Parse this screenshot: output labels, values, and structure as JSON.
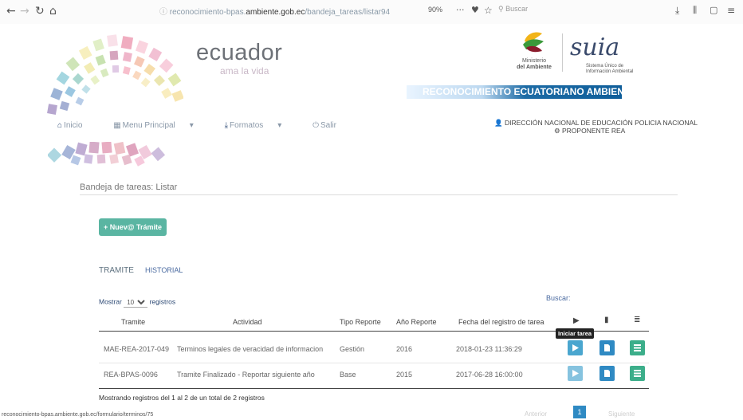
{
  "browser": {
    "url_prefix": "reconocimiento-bpas.",
    "url_domain": "ambiente.gob.ec",
    "url_path": "/bandeja_tareas/listar94",
    "zoom": "90%",
    "search_placeholder": "Buscar"
  },
  "logo": {
    "title": "ecuador",
    "subtitle": "ama la vida"
  },
  "ministry": {
    "line1": "Ministerio",
    "line2": "del Ambiente"
  },
  "suia": {
    "title": "suia",
    "subtitle_line1": "Sistema Único de",
    "subtitle_line2": "Información Ambiental"
  },
  "banner": "RECONOCIMIENTO ECUATORIANO AMBIENTAL",
  "menu": {
    "inicio": "Inicio",
    "principal": "Menu Principal",
    "formatos": "Formatos",
    "salir": "Salir"
  },
  "user": {
    "org": "DIRECCIÓN NACIONAL DE EDUCACIÓN POLICIA NACIONAL",
    "role": "PROPONENTE REA"
  },
  "breadcrumb": "Bandeja de tareas: Listar",
  "new_button": "Nuev@ Trámite",
  "tabs": {
    "tramite": "TRAMITE",
    "historial": "HISTORIAL"
  },
  "table_controls": {
    "show_label": "Mostrar",
    "show_value": "10",
    "records_label": "registros",
    "search_label": "Buscar:"
  },
  "table": {
    "headers": [
      "Tramite",
      "Actividad",
      "Tipo Reporte",
      "Año Reporte",
      "Fecha del registro de tarea"
    ],
    "rows": [
      {
        "tramite": "MAE-REA-2017-049",
        "actividad": "Terminos legales de veracidad de informacion",
        "tipo": "Gestión",
        "anio": "2016",
        "fecha": "2018-01-23 11:36:29"
      },
      {
        "tramite": "REA-BPAS-0096",
        "actividad": "Tramite Finalizado - Reportar siguiente año",
        "tipo": "Base",
        "anio": "2015",
        "fecha": "2017-06-28 16:00:00"
      }
    ],
    "tooltip": "Iniciar tarea"
  },
  "footer": {
    "info": "Mostrando registros del 1 al 2 de un total de 2 registros",
    "prev": "Anterior",
    "page": "1",
    "next": "Siguiente"
  },
  "status_url": "reconocimiento-bpas.ambiente.gob.ec/formulario/terminos/75",
  "colors": {
    "new_button": "#5ab5a2",
    "play": "#4aa6cf",
    "doc": "#2f8ac3",
    "list": "#3cae8a",
    "banner": "#0f5e9a"
  }
}
